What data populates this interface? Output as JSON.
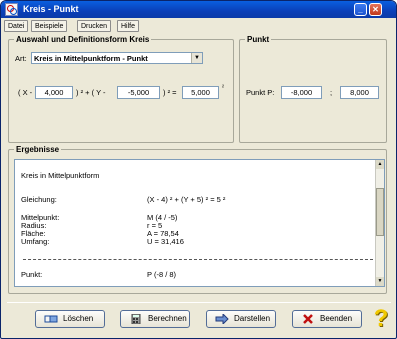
{
  "window": {
    "title": "Kreis - Punkt"
  },
  "menu": [
    "Datei",
    "Beispiele",
    "Drucken",
    "Hilfe"
  ],
  "definition": {
    "legend": "Auswahl und Definitionsform Kreis",
    "art_label": "Art:",
    "art_value": "Kreis in Mittelpunktform - Punkt",
    "eq_open": "( X -",
    "x_value": "4,000",
    "eq_mid": ") ² + ( Y -",
    "y_value": "-5,000",
    "eq_close": ") ² =",
    "r_value": "5,000",
    "eq_sup": "²"
  },
  "point": {
    "legend": "Punkt",
    "label": "Punkt P:",
    "x_value": "-8,000",
    "separator": ";",
    "y_value": "8,000"
  },
  "results": {
    "legend": "Ergebnisse",
    "heading": "Kreis in Mittelpunktform",
    "rows": [
      {
        "label": "Gleichung:",
        "value": "(X - 4) ² + (Y + 5) ² = 5 ²"
      },
      {
        "label": "Mittelpunkt:",
        "value": "M (4 / -5)"
      },
      {
        "label": "Radius:",
        "value": "r = 5"
      },
      {
        "label": "Fläche:",
        "value": "A = 78,54"
      },
      {
        "label": "Umfang:",
        "value": "U = 31,416"
      },
      {
        "label": "Punkt:",
        "value": "P (-8 / 8)"
      }
    ]
  },
  "buttons": {
    "clear": "Löschen",
    "calc": "Berechnen",
    "show": "Darstellen",
    "quit": "Beenden",
    "help": "?"
  }
}
